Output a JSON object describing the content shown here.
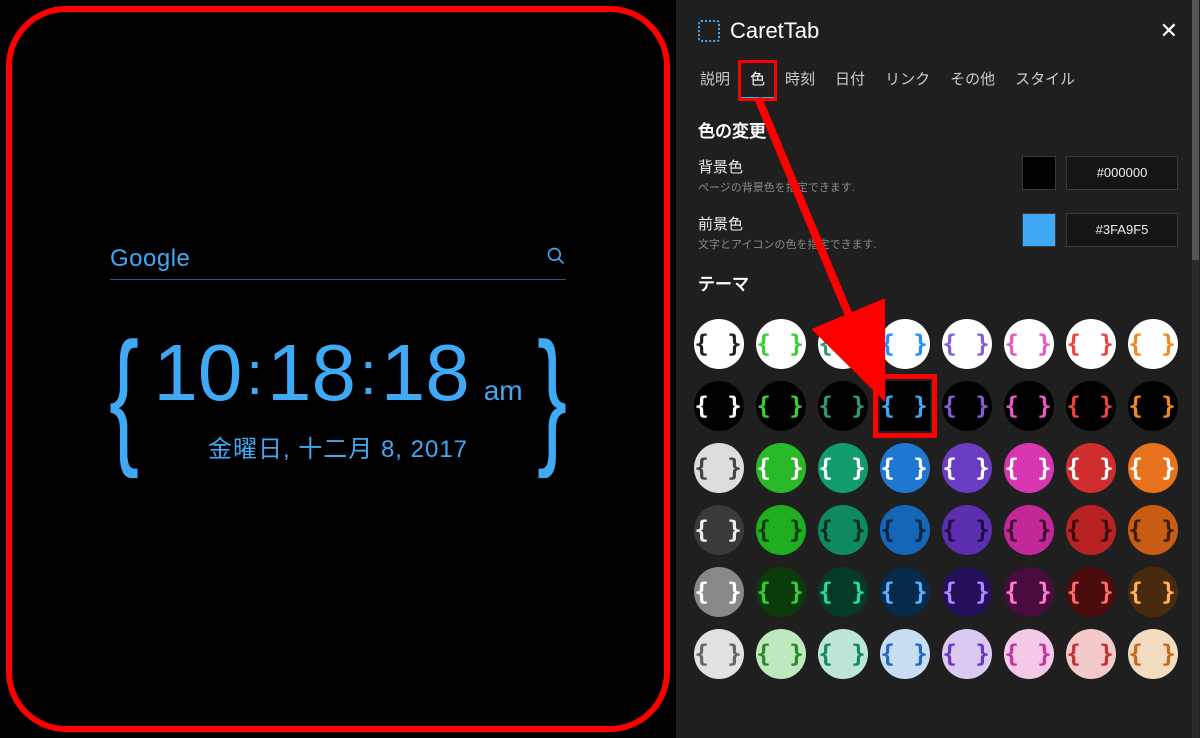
{
  "preview": {
    "search_placeholder": "Google",
    "time_h": "10",
    "time_m": "18",
    "time_s": "18",
    "ampm": "am",
    "date_text": "金曜日, 十二月 8, 2017"
  },
  "panel": {
    "app_title": "CaretTab",
    "tabs": [
      "説明",
      "色",
      "時刻",
      "日付",
      "リンク",
      "その他",
      "スタイル"
    ],
    "active_tab_index": 1,
    "section_title": "色の変更",
    "bg_row": {
      "label": "背景色",
      "hint": "ページの背景色を指定できます.",
      "swatch": "#000000",
      "hex": "#000000"
    },
    "fg_row": {
      "label": "前景色",
      "hint": "文字とアイコンの色を指定できます.",
      "swatch": "#3FA9F5",
      "hex": "#3FA9F5"
    },
    "theme_title": "テーマ",
    "themes": [
      {
        "bg": "#FFFFFF",
        "fg": "#222222"
      },
      {
        "bg": "#FFFFFF",
        "fg": "#3ACC3A"
      },
      {
        "bg": "#FFFFFF",
        "fg": "#2D9C6F"
      },
      {
        "bg": "#FFFFFF",
        "fg": "#1E90FF"
      },
      {
        "bg": "#FFFFFF",
        "fg": "#8A5BD8"
      },
      {
        "bg": "#FFFFFF",
        "fg": "#E858C6"
      },
      {
        "bg": "#FFFFFF",
        "fg": "#E84545"
      },
      {
        "bg": "#FFFFFF",
        "fg": "#F08A1E"
      },
      {
        "bg": "#000000",
        "fg": "#FFFFFF"
      },
      {
        "bg": "#000000",
        "fg": "#3ACC3A"
      },
      {
        "bg": "#000000",
        "fg": "#2D9C6F"
      },
      {
        "bg": "#000000",
        "fg": "#3FA9F5",
        "selected": true
      },
      {
        "bg": "#000000",
        "fg": "#8A5BD8"
      },
      {
        "bg": "#000000",
        "fg": "#E858C6"
      },
      {
        "bg": "#000000",
        "fg": "#E84545"
      },
      {
        "bg": "#000000",
        "fg": "#F08A1E"
      },
      {
        "bg": "#DDDDDD",
        "fg": "#444444"
      },
      {
        "bg": "#28B828",
        "fg": "#FFFFFF"
      },
      {
        "bg": "#109C6F",
        "fg": "#FFFFFF"
      },
      {
        "bg": "#1E78D2",
        "fg": "#FFFFFF"
      },
      {
        "bg": "#6A3CC2",
        "fg": "#FFFFFF"
      },
      {
        "bg": "#D836B0",
        "fg": "#FFFFFF"
      },
      {
        "bg": "#D02E2E",
        "fg": "#FFFFFF"
      },
      {
        "bg": "#E8721E",
        "fg": "#FFFFFF"
      },
      {
        "bg": "#3A3A3A",
        "fg": "#EEEEEE"
      },
      {
        "bg": "#1FAE1F",
        "fg": "#0B3B0B"
      },
      {
        "bg": "#0E8A60",
        "fg": "#042E20"
      },
      {
        "bg": "#1566B8",
        "fg": "#06243E"
      },
      {
        "bg": "#5C2EB0",
        "fg": "#1E0C3E"
      },
      {
        "bg": "#C22898",
        "fg": "#3E0C32"
      },
      {
        "bg": "#B82222",
        "fg": "#3E0808"
      },
      {
        "bg": "#C85C14",
        "fg": "#3E1C06"
      },
      {
        "bg": "#888888",
        "fg": "#FFFFFF"
      },
      {
        "bg": "#0B3B0B",
        "fg": "#3ACC3A"
      },
      {
        "bg": "#063A28",
        "fg": "#2ED89A"
      },
      {
        "bg": "#082A4A",
        "fg": "#58B0FF"
      },
      {
        "bg": "#24105A",
        "fg": "#B088FF"
      },
      {
        "bg": "#4A0C3C",
        "fg": "#FF7AD0"
      },
      {
        "bg": "#4A0C0C",
        "fg": "#FF6A6A"
      },
      {
        "bg": "#4A2A0C",
        "fg": "#FFB05A"
      },
      {
        "bg": "#E2E2E2",
        "fg": "#666666"
      },
      {
        "bg": "#BFE8BF",
        "fg": "#2A8A2A"
      },
      {
        "bg": "#BDE6D8",
        "fg": "#148A60"
      },
      {
        "bg": "#C8DEF2",
        "fg": "#1E6AC2"
      },
      {
        "bg": "#DACAF2",
        "fg": "#6A38C2"
      },
      {
        "bg": "#F4C9E8",
        "fg": "#C234A0"
      },
      {
        "bg": "#F4C9C9",
        "fg": "#C23434"
      },
      {
        "bg": "#F4DCC0",
        "fg": "#C26A1E"
      }
    ]
  }
}
